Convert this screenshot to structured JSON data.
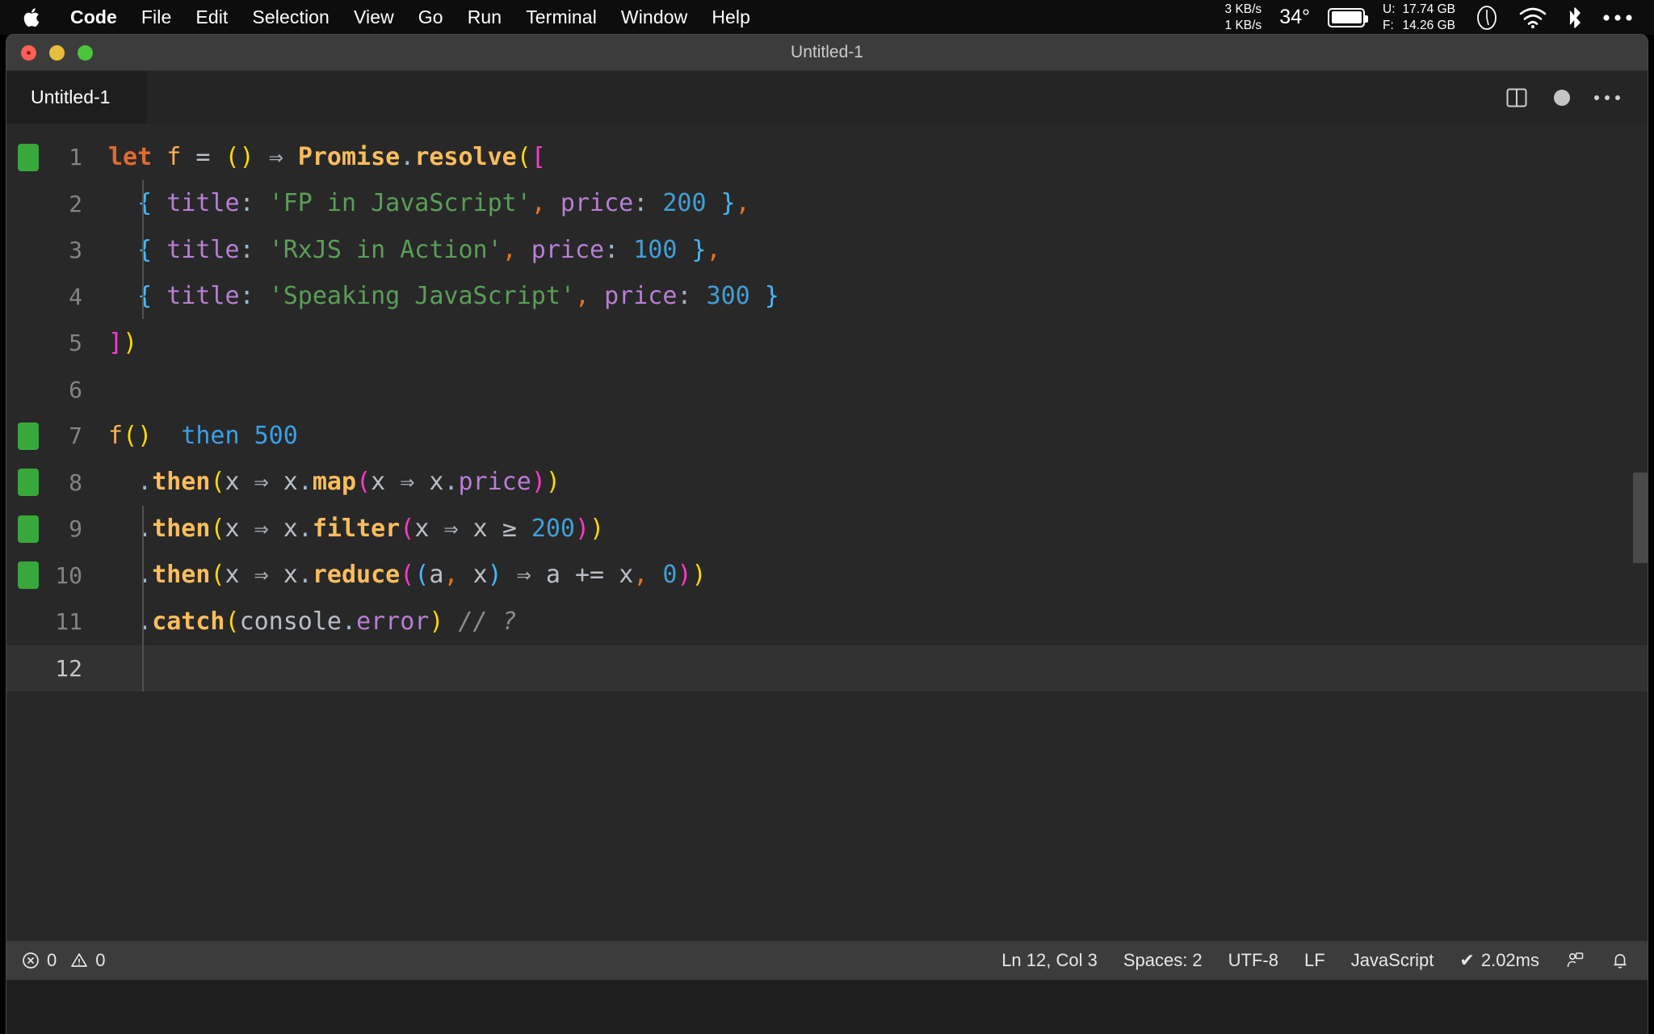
{
  "menubar": {
    "apple_icon": "apple-logo",
    "items": [
      {
        "label": "Code",
        "bold": true
      },
      {
        "label": "File",
        "bold": false
      },
      {
        "label": "Edit",
        "bold": false
      },
      {
        "label": "Selection",
        "bold": false
      },
      {
        "label": "View",
        "bold": false
      },
      {
        "label": "Go",
        "bold": false
      },
      {
        "label": "Run",
        "bold": false
      },
      {
        "label": "Terminal",
        "bold": false
      },
      {
        "label": "Window",
        "bold": false
      },
      {
        "label": "Help",
        "bold": false
      }
    ],
    "status": {
      "net_up": "3 KB/s",
      "net_down": "1 KB/s",
      "temperature": "34°",
      "battery_icon": "battery-icon",
      "mem_used_label": "U:",
      "mem_free_label": "F:",
      "mem_used_value": "17.74 GB",
      "mem_free_value": "14.26 GB",
      "clock_icon": "clock-icon",
      "wifi_icon": "wifi-icon",
      "bluetooth_icon": "bluetooth-icon",
      "more_icon": "control-center-icon"
    }
  },
  "window": {
    "title": "Untitled-1",
    "traffic_lights": {
      "close": "close-button",
      "minimize": "minimize-button",
      "maximize": "maximize-button"
    }
  },
  "tabs": [
    {
      "label": "Untitled-1",
      "active": true
    }
  ],
  "editor_actions": {
    "split_editor": "split-editor-icon",
    "unsaved_indicator": "unsaved-dot-icon",
    "more_actions": "more-actions-icon"
  },
  "editor": {
    "language_hint": "JavaScript",
    "inline_hint_line7": "then 500",
    "lines": [
      {
        "n": "1",
        "marker": true,
        "current": false
      },
      {
        "n": "2",
        "marker": false,
        "current": false
      },
      {
        "n": "3",
        "marker": false,
        "current": false
      },
      {
        "n": "4",
        "marker": false,
        "current": false
      },
      {
        "n": "5",
        "marker": false,
        "current": false
      },
      {
        "n": "6",
        "marker": false,
        "current": false
      },
      {
        "n": "7",
        "marker": true,
        "current": false
      },
      {
        "n": "8",
        "marker": true,
        "current": false
      },
      {
        "n": "9",
        "marker": true,
        "current": false
      },
      {
        "n": "10",
        "marker": true,
        "current": false
      },
      {
        "n": "11",
        "marker": false,
        "current": false
      },
      {
        "n": "12",
        "marker": false,
        "current": true
      }
    ],
    "text": {
      "l1_let": "let",
      "l1_f": "f",
      "l1_eq": "=",
      "l1_paren_open": "(",
      "l1_paren_close": ")",
      "l1_arrow": "⇒",
      "l1_promise": "Promise",
      "l1_dot": ".",
      "l1_resolve": "resolve",
      "l1_lparen": "(",
      "l1_lbracket": "[",
      "l2_lbrace": "{",
      "l2_title": "title",
      "l2_colon": ":",
      "l2_string": "'FP in JavaScript'",
      "l2_comma": ",",
      "l2_price": "price",
      "l2_colon2": ":",
      "l2_num": "200",
      "l2_rbrace": "}",
      "l2_comma2": ",",
      "l3_lbrace": "{",
      "l3_title": "title",
      "l3_colon": ":",
      "l3_string": "'RxJS in Action'",
      "l3_comma": ",",
      "l3_price": "price",
      "l3_colon2": ":",
      "l3_num": "100",
      "l3_rbrace": "}",
      "l3_comma2": ",",
      "l4_lbrace": "{",
      "l4_title": "title",
      "l4_colon": ":",
      "l4_string": "'Speaking JavaScript'",
      "l4_comma": ",",
      "l4_price": "price",
      "l4_colon2": ":",
      "l4_num": "300",
      "l4_rbrace": "}",
      "l5_rbracket": "]",
      "l5_rparen": ")",
      "l7_f": "f",
      "l7_lparen": "(",
      "l7_rparen": ")",
      "l7_hint": "then 500",
      "l8_dot": ".",
      "l8_then": "then",
      "l8_lparen": "(",
      "l8_x1": "x",
      "l8_arrow": "⇒",
      "l8_x2": "x",
      "l8_dot2": ".",
      "l8_map": "map",
      "l8_lparen2": "(",
      "l8_x3": "x",
      "l8_arrow2": "⇒",
      "l8_x4": "x",
      "l8_dot3": ".",
      "l8_price": "price",
      "l8_rparen2": ")",
      "l8_rparen": ")",
      "l9_dot": ".",
      "l9_then": "then",
      "l9_lparen": "(",
      "l9_x1": "x",
      "l9_arrow": "⇒",
      "l9_x2": "x",
      "l9_dot2": ".",
      "l9_filter": "filter",
      "l9_lparen2": "(",
      "l9_x3": "x",
      "l9_arrow2": "⇒",
      "l9_x4": "x",
      "l9_ge": "≥",
      "l9_num": "200",
      "l9_rparen2": ")",
      "l9_rparen": ")",
      "l10_dot": ".",
      "l10_then": "then",
      "l10_lparen": "(",
      "l10_x1": "x",
      "l10_arrow": "⇒",
      "l10_x2": "x",
      "l10_dot2": ".",
      "l10_reduce": "reduce",
      "l10_lparen2": "(",
      "l10_lparen3": "(",
      "l10_a": "a",
      "l10_comma": ",",
      "l10_x3": "x",
      "l10_rparen3": ")",
      "l10_arrow2": "⇒",
      "l10_a2": "a",
      "l10_pluseq": "+=",
      "l10_x4": "x",
      "l10_comma2": ",",
      "l10_zero": "0",
      "l10_rparen2": ")",
      "l10_rparen": ")",
      "l11_dot": ".",
      "l11_catch": "catch",
      "l11_lparen": "(",
      "l11_console": "console",
      "l11_dot2": ".",
      "l11_error": "error",
      "l11_rparen": ")",
      "l11_comment": "// ?"
    }
  },
  "statusbar": {
    "errors_icon": "error-icon",
    "errors_count": "0",
    "warnings_icon": "warning-icon",
    "warnings_count": "0",
    "cursor_position": "Ln 12, Col 3",
    "indentation": "Spaces: 2",
    "encoding": "UTF-8",
    "eol": "LF",
    "language": "JavaScript",
    "runtime_check": "✔",
    "runtime": "2.02ms",
    "remote_icon": "remote-window-icon",
    "bell_icon": "notifications-bell-icon"
  }
}
